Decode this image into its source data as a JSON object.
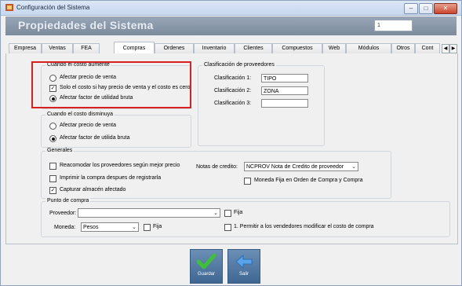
{
  "window": {
    "title": "Configuración del Sistema"
  },
  "header": {
    "title": "Propiedades del Sistema",
    "field_value": "1"
  },
  "tabs": [
    "Empresa",
    "Ventas",
    "FEA",
    "Compras",
    "Ordenes",
    "Inventario",
    "Clientes",
    "Compuestos",
    "Web",
    "Módulos",
    "Otros",
    "Cont"
  ],
  "active_tab": "Compras",
  "costo_aumente": {
    "label": "Cuando el costo aumente",
    "options": [
      "Afectar precio de venta",
      "Solo el costo si hay precio de venta y el costo es cero",
      "Afectar factor de utilidad bruta"
    ]
  },
  "costo_disminuya": {
    "label": "Cuando el costo disminuya",
    "options": [
      "Afectar precio de venta",
      "Afectar factor de utilida bruta"
    ]
  },
  "clasificacion": {
    "label": "Clasificación de proveedores",
    "fields": [
      {
        "label": "Clasificación 1:",
        "value": "TIPO"
      },
      {
        "label": "Clasificación 2:",
        "value": "ZONA"
      },
      {
        "label": "Clasificación 3:",
        "value": ""
      }
    ]
  },
  "generales": {
    "label": "Generales",
    "checks": [
      "Reacomodar los proveedores según mejor precio",
      "Imprimir la compra despues de registrarla",
      "Capturar almacén afectado"
    ],
    "notas_label": "Notas de credito:",
    "notas_value": "NCPROV Nota de Credito de proveedor",
    "moneda_fija": "Moneda Fija en Orden de Compra y Compra"
  },
  "punto_compra": {
    "label": "Punto de compra",
    "proveedor_label": "Proveedor:",
    "proveedor_value": "",
    "fija1": "Fija",
    "moneda_label": "Moneda:",
    "moneda_value": "Pesos",
    "fija2": "Fija",
    "permitir": "1. Permitir a los vendedores modificar el costo de compra"
  },
  "buttons": {
    "guardar": "Guardar",
    "salir": "Salir"
  },
  "colors": {
    "highlight": "#d92020",
    "header": "#8896a6",
    "button": "#4f77a2"
  }
}
